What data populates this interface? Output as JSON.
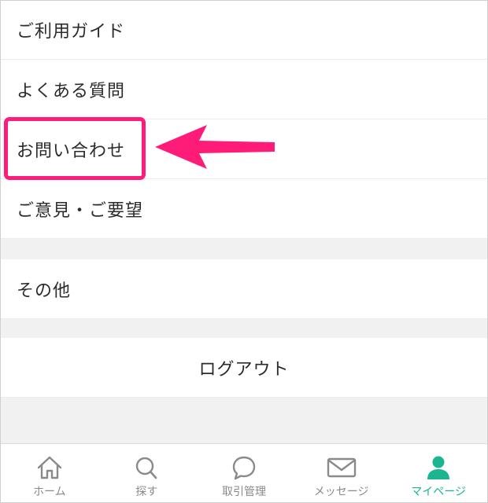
{
  "menu": {
    "items": [
      {
        "label": "ご利用ガイド"
      },
      {
        "label": "よくある質問"
      },
      {
        "label": "お問い合わせ"
      },
      {
        "label": "ご意見・ご要望"
      },
      {
        "label": "その他"
      }
    ],
    "logout_label": "ログアウト"
  },
  "tabbar": {
    "tabs": [
      {
        "label": "ホーム",
        "icon": "home-icon"
      },
      {
        "label": "探す",
        "icon": "search-icon"
      },
      {
        "label": "取引管理",
        "icon": "chat-bubble-icon"
      },
      {
        "label": "メッセージ",
        "icon": "envelope-icon"
      },
      {
        "label": "マイページ",
        "icon": "person-icon",
        "active": true
      }
    ]
  },
  "colors": {
    "highlight": "#ff1c78",
    "active_tab": "#1bb58f",
    "inactive_tab": "#8a8a8a",
    "section_gap": "#f1f1f1"
  }
}
